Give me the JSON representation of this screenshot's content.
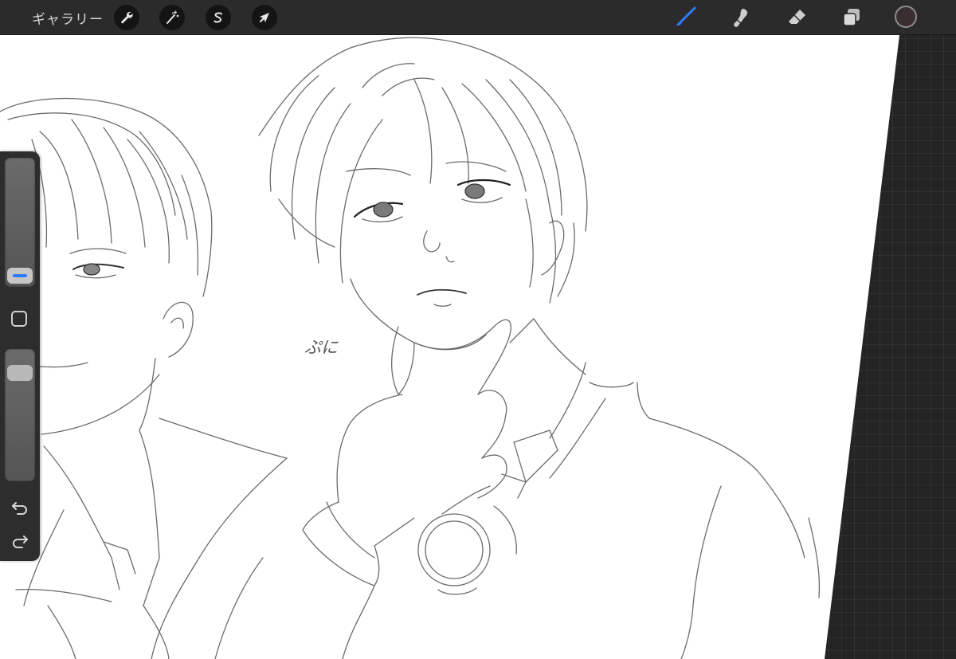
{
  "topbar": {
    "gallery_label": "ギャラリー",
    "actions_icon": "wrench-icon",
    "adjustments_icon": "magic-wand-icon",
    "selection_icon": "selection-s-icon",
    "transform_icon": "arrow-cursor-icon",
    "brush_icon": "brush-icon",
    "smudge_icon": "smudge-icon",
    "eraser_icon": "eraser-icon",
    "layers_icon": "layers-icon",
    "active_tool": "brush",
    "accent_color": "#2f7bff",
    "current_color": "#3a2e31"
  },
  "sidebar": {
    "brush_size_level": 0.2,
    "opacity_level": 0.9,
    "modify_icon": "square-modify-icon",
    "undo_icon": "undo-icon",
    "redo_icon": "redo-icon"
  },
  "canvas": {
    "handwritten_text": "ぷに"
  }
}
